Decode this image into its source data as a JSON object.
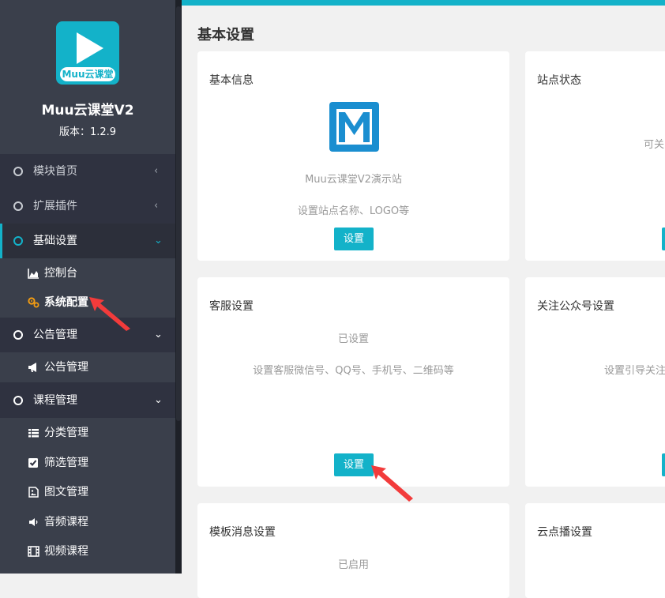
{
  "sidebar": {
    "brand_tag": "Muu云课堂",
    "app_name": "Muu云课堂V2",
    "version": "版本：1.2.9",
    "menu": [
      {
        "label": "模块首页",
        "chev": "‹"
      },
      {
        "label": "扩展插件",
        "chev": "‹"
      },
      {
        "label": "基础设置",
        "chev": "⌄"
      },
      {
        "label": "公告管理",
        "chev": "⌄"
      },
      {
        "label": "课程管理",
        "chev": "⌄"
      }
    ],
    "sub": {
      "dashboard": "控制台",
      "system_config": "系统配置",
      "notice_mgmt": "公告管理",
      "category_mgmt": "分类管理",
      "filter_mgmt": "筛选管理",
      "article_mgmt": "图文管理",
      "audio_course": "音频课程",
      "video_course": "视频课程"
    }
  },
  "main": {
    "page_title": "基本设置",
    "cards": [
      {
        "title": "基本信息",
        "site_name": "Muu云课堂V2演示站",
        "desc": "设置站点名称、LOGO等",
        "button": "设置"
      },
      {
        "title": "站点状态",
        "desc": "可关闭"
      },
      {
        "title": "客服设置",
        "status": "已设置",
        "desc": "设置客服微信号、QQ号、手机号、二维码等",
        "button": "设置"
      },
      {
        "title": "关注公众号设置",
        "desc": "设置引导关注"
      },
      {
        "title": "模板消息设置",
        "status": "已启用"
      },
      {
        "title": "云点播设置"
      }
    ]
  },
  "colors": {
    "accent": "#13b2c9",
    "sidebar": "#2f3240",
    "annotation": "#f23b3b"
  }
}
